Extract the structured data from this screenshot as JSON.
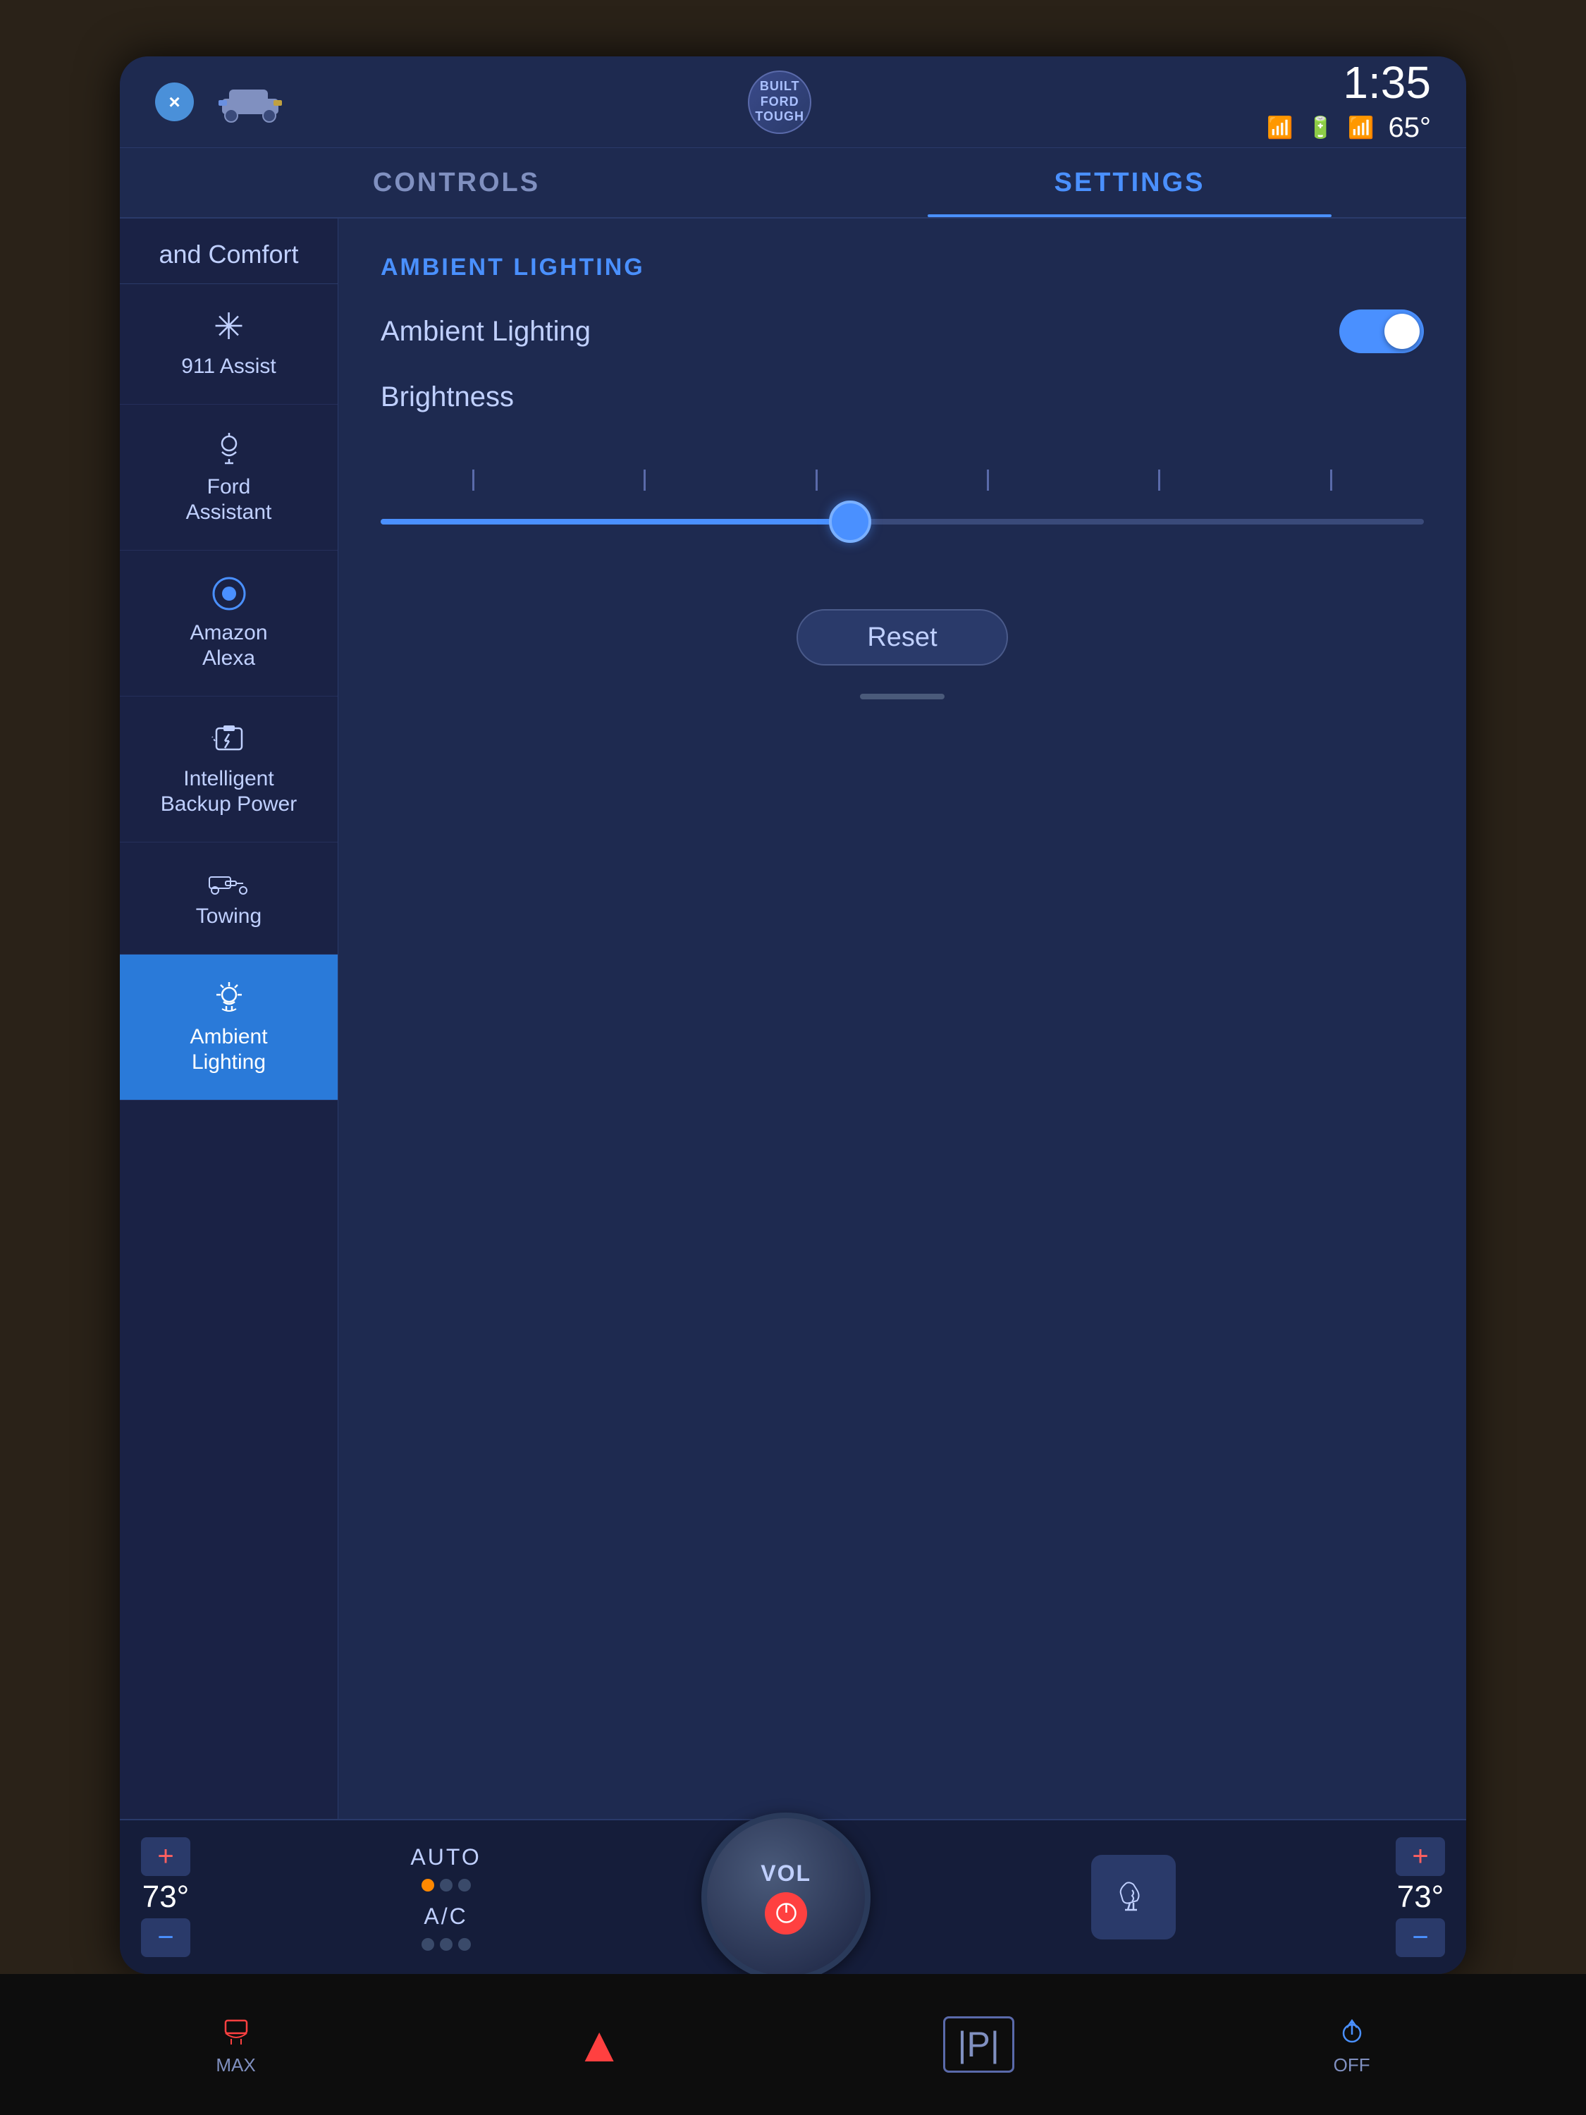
{
  "statusBar": {
    "time": "1:35",
    "temperature": "65°",
    "fordLogoText": "BUILT\nFORD\nTOUGH"
  },
  "tabs": [
    {
      "id": "controls",
      "label": "CONTROLS",
      "active": false
    },
    {
      "id": "settings",
      "label": "SETTINGS",
      "active": true
    }
  ],
  "sidebar": {
    "header": "and Comfort",
    "items": [
      {
        "id": "911-assist",
        "icon": "✳",
        "label": "911 Assist",
        "active": false
      },
      {
        "id": "ford-assistant",
        "icon": "🎤",
        "label": "Ford\nAssistant",
        "active": false
      },
      {
        "id": "amazon-alexa",
        "icon": "◯",
        "label": "Amazon\nAlexa",
        "active": false
      },
      {
        "id": "intelligent-backup",
        "icon": "⚡",
        "label": "Intelligent\nBackup Power",
        "active": false
      },
      {
        "id": "towing",
        "icon": "🚛",
        "label": "Towing",
        "active": false
      },
      {
        "id": "ambient-lighting",
        "icon": "💡",
        "label": "Ambient\nLighting",
        "active": true
      }
    ]
  },
  "settingsPanel": {
    "sectionTitle": "AMBIENT LIGHTING",
    "settings": [
      {
        "id": "ambient-lighting-toggle",
        "label": "Ambient Lighting",
        "type": "toggle",
        "value": true
      },
      {
        "id": "brightness-setting",
        "label": "Brightness",
        "type": "slider",
        "value": 45
      }
    ],
    "resetButton": "Reset"
  },
  "bottomControls": {
    "leftTemp": "73°",
    "rightTemp": "73°",
    "autoLabel": "AUTO",
    "acLabel": "A/C",
    "volLabel": "VOL",
    "scrollIndicator": ""
  },
  "physicalButtons": [
    {
      "id": "max-defrost",
      "icon": "❄",
      "label": "MAX"
    },
    {
      "id": "hazard",
      "icon": "▲",
      "label": ""
    },
    {
      "id": "park",
      "icon": "|P|",
      "label": ""
    },
    {
      "id": "off",
      "icon": "🔒",
      "label": "OFF"
    }
  ]
}
